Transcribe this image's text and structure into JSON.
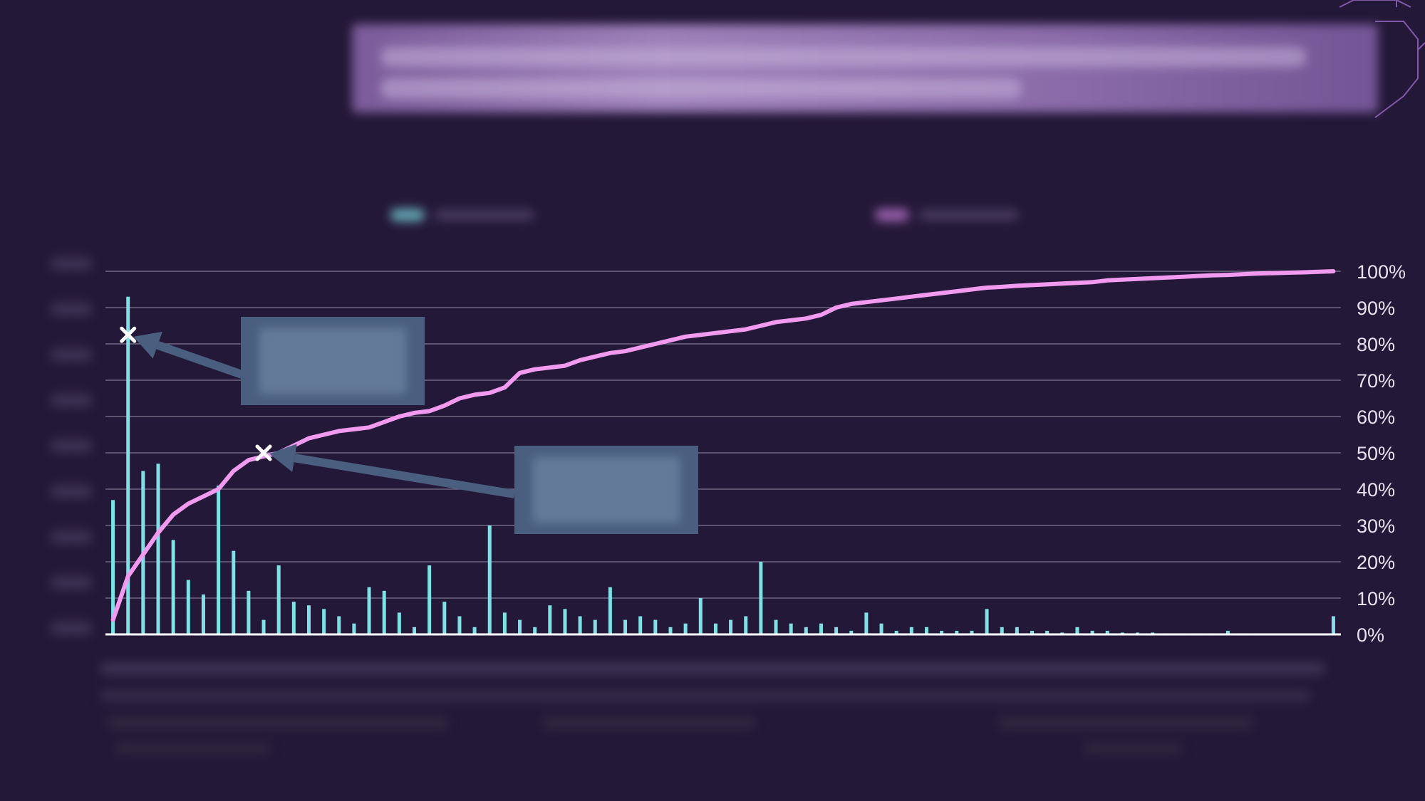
{
  "header": {
    "title": "",
    "banner_text": ""
  },
  "colors": {
    "background": "#241838",
    "bars": "#7fe0e6",
    "cumulative_line": "#f19af0",
    "annotation": "#4a5f80"
  },
  "chart_data": {
    "type": "bar",
    "title": "",
    "legend": {
      "placement": "top"
    },
    "grid": true,
    "y2_ticks": [
      "0%",
      "10%",
      "20%",
      "30%",
      "40%",
      "50%",
      "60%",
      "70%",
      "80%",
      "90%",
      "100%"
    ],
    "y2lim": [
      0,
      100
    ],
    "ylim": [
      0,
      100
    ],
    "series": [
      {
        "kind": "bar",
        "values": [
          37,
          93,
          45,
          47,
          26,
          15,
          11,
          41,
          23,
          12,
          4,
          19,
          9,
          8,
          7,
          5,
          3,
          13,
          12,
          6,
          2,
          19,
          9,
          5,
          2,
          30,
          6,
          4,
          2,
          8,
          7,
          5,
          4,
          13,
          4,
          5,
          4,
          2,
          3,
          10,
          3,
          4,
          5,
          20,
          4,
          3,
          2,
          3,
          2,
          1,
          6,
          3,
          1,
          2,
          2,
          1,
          1,
          1,
          7,
          2,
          2,
          1,
          1,
          0.5,
          2,
          1,
          1,
          0.5,
          0.5,
          0.5,
          0.3,
          0.3,
          0.3,
          0.3,
          1,
          0.3,
          0.3,
          0.2,
          0.2,
          0.2,
          0.2,
          5
        ]
      },
      {
        "kind": "line",
        "values": [
          4,
          16,
          22,
          28,
          33,
          36,
          38,
          40,
          45,
          48,
          49,
          50,
          52,
          54,
          55,
          56,
          56.5,
          57,
          58.5,
          60,
          61,
          61.5,
          63,
          65,
          66,
          66.5,
          68,
          72,
          73,
          73.5,
          74,
          75.5,
          76.5,
          77.5,
          78,
          79,
          80,
          81,
          82,
          82.5,
          83,
          83.5,
          84,
          85,
          86,
          86.5,
          87,
          88,
          90,
          91,
          91.5,
          92,
          92.5,
          93,
          93.5,
          94,
          94.5,
          95,
          95.5,
          95.7,
          96,
          96.2,
          96.4,
          96.6,
          96.8,
          97,
          97.5,
          97.7,
          97.9,
          98.1,
          98.3,
          98.5,
          98.7,
          98.9,
          99,
          99.2,
          99.4,
          99.5,
          99.6,
          99.7,
          99.85,
          100
        ]
      }
    ],
    "annotations": [
      {
        "target_index": 1,
        "value": 82.5,
        "text": ""
      },
      {
        "target_index": 10,
        "value": 50,
        "text": ""
      }
    ]
  }
}
